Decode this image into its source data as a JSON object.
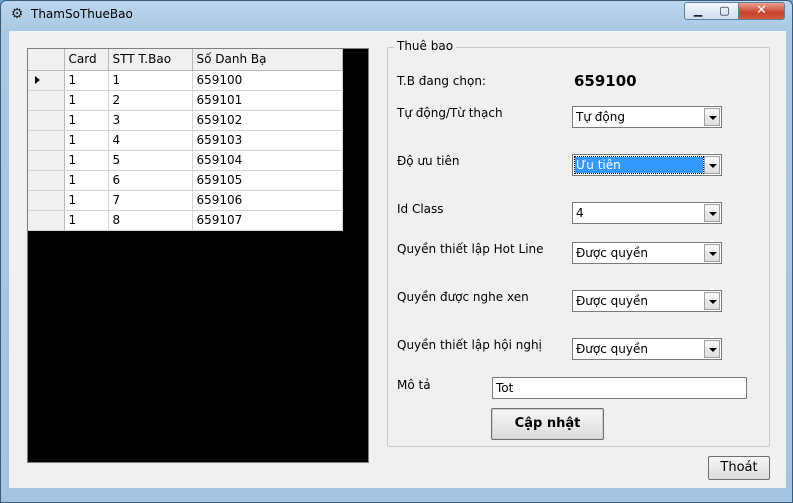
{
  "window": {
    "title": "ThamSoThueBao"
  },
  "grid": {
    "columns": [
      "Card",
      "STT T.Bao",
      "Số Danh Bạ"
    ],
    "rows": [
      [
        "1",
        "1",
        "659100"
      ],
      [
        "1",
        "2",
        "659101"
      ],
      [
        "1",
        "3",
        "659102"
      ],
      [
        "1",
        "4",
        "659103"
      ],
      [
        "1",
        "5",
        "659104"
      ],
      [
        "1",
        "6",
        "659105"
      ],
      [
        "1",
        "7",
        "659106"
      ],
      [
        "1",
        "8",
        "659107"
      ]
    ]
  },
  "panel": {
    "legend": "Thuê bao",
    "selected_label": "T.B đang chọn:",
    "selected_value": "659100",
    "fields": [
      {
        "label": "Tự động/Từ thạch",
        "value": "Tự động"
      },
      {
        "label": "Độ ưu tiên",
        "value": "Ưu tiên"
      },
      {
        "label": "Id Class",
        "value": "4"
      },
      {
        "label": "Quyền thiết lập Hot Line",
        "value": "Được quyền"
      },
      {
        "label": "Quyền được nghe xen",
        "value": "Được quyền"
      },
      {
        "label": "Quyền thiết lập hội nghị",
        "value": "Được quyền"
      }
    ],
    "description_label": "Mô tả",
    "description_value": "Tot",
    "update_button": "Cập nhật"
  },
  "exit_button": "Thoát",
  "icons": {
    "app": "tools-icon",
    "minimize": "minimize-icon",
    "maximize": "maximize-icon",
    "close": "close-icon"
  }
}
